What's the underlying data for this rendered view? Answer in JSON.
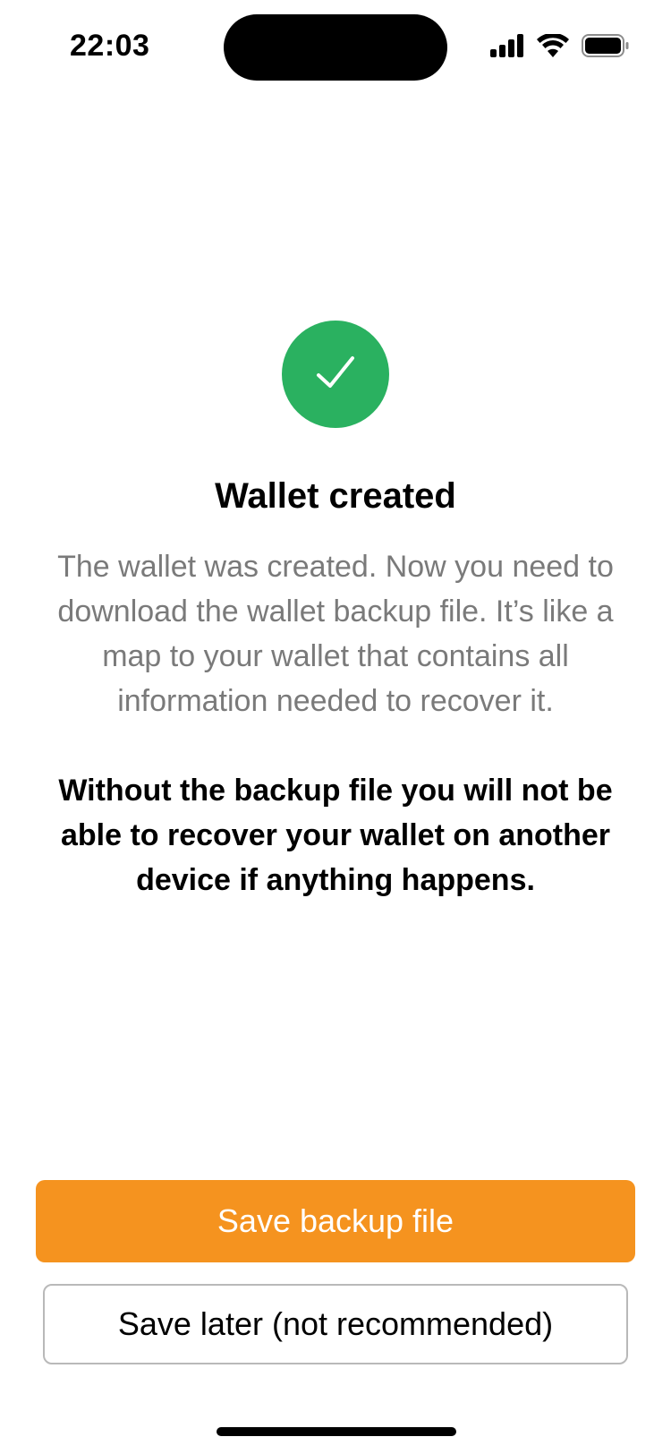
{
  "status_bar": {
    "time": "22:03",
    "icons": [
      "signal-icon",
      "wifi-icon",
      "battery-icon"
    ]
  },
  "success": {
    "icon": "checkmark-icon",
    "color": "#2ab160"
  },
  "title": "Wallet created",
  "description": "The wallet was created. Now you need to download the wallet backup file. It’s like a map to your wallet that contains all information needed to recover it.",
  "warning": "Without the backup file you will not be able to recover your wallet on another device if anything happens.",
  "actions": {
    "primary_label": "Save backup file",
    "primary_color": "#f5931f",
    "secondary_label": "Save later (not recommended)"
  }
}
